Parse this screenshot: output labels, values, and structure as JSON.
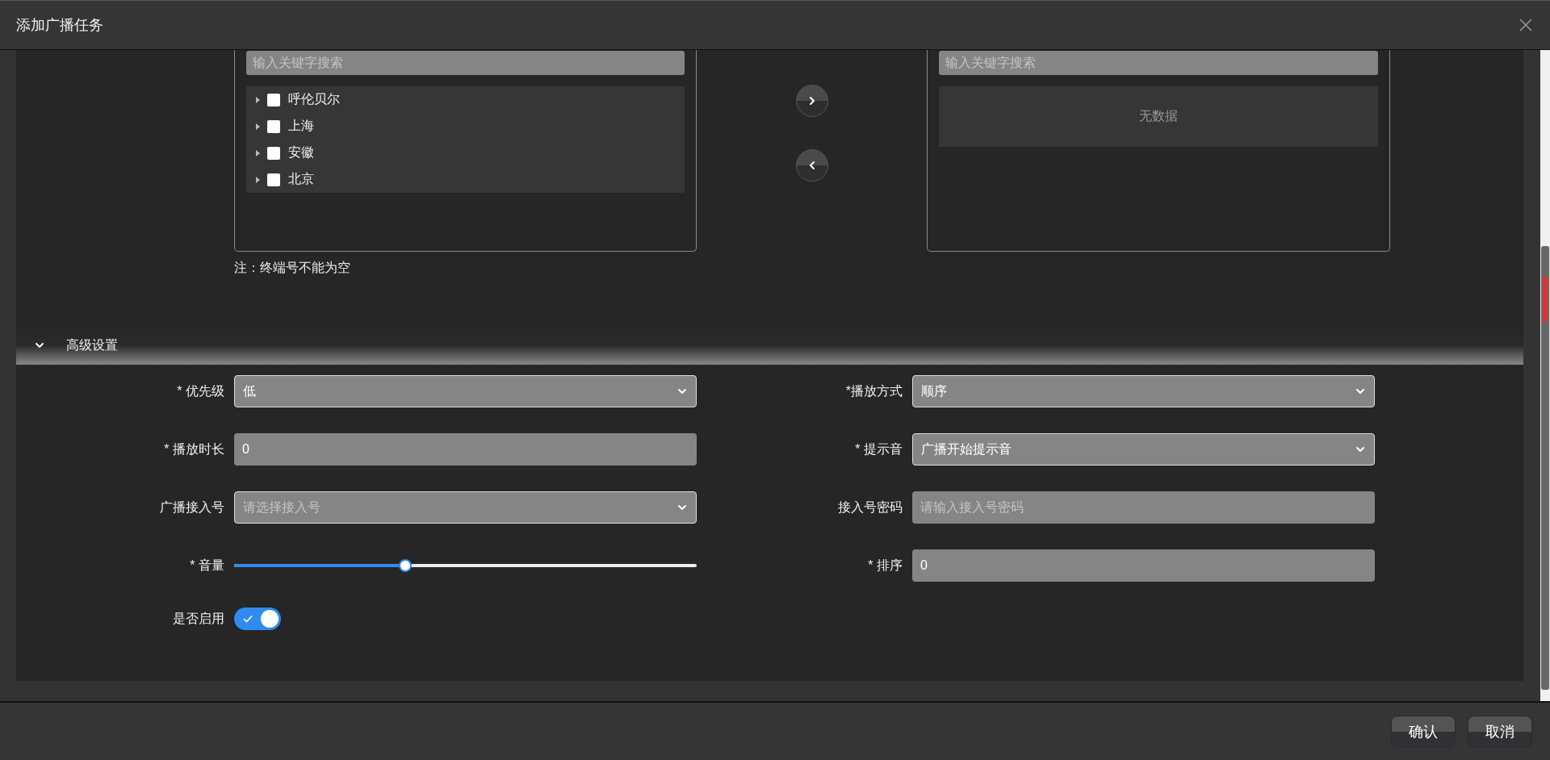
{
  "window": {
    "title": "添加广播任务"
  },
  "transfer": {
    "source": {
      "search": {
        "placeholder": "输入关键字搜索"
      },
      "tree": [
        {
          "label": "呼伦贝尔",
          "checked": false,
          "expanded": false
        },
        {
          "label": "上海",
          "checked": false,
          "expanded": false
        },
        {
          "label": "安徽",
          "checked": false,
          "expanded": false
        },
        {
          "label": "北京",
          "checked": false,
          "expanded": false
        }
      ]
    },
    "target": {
      "search": {
        "placeholder": "输入关键字搜索"
      },
      "empty": "无数据"
    },
    "note": "注：终端号不能为空"
  },
  "advanced": {
    "title": "高级设置",
    "expanded": true,
    "fields": [
      {
        "kind": "select",
        "label": "* 优先级",
        "value": "低"
      },
      {
        "kind": "select",
        "label": "*播放方式",
        "value": "顺序"
      },
      {
        "kind": "input",
        "label": "* 播放时长",
        "value": "0"
      },
      {
        "kind": "select",
        "label": "* 提示音",
        "value": "广播开始提示音"
      },
      {
        "kind": "select",
        "label": "广播接入号",
        "placeholder": "请选择接入号"
      },
      {
        "kind": "input",
        "label": "接入号密码",
        "placeholder": "请输入接入号密码"
      },
      {
        "kind": "slider",
        "label": "* 音量",
        "level": 0.37
      },
      {
        "kind": "input",
        "label": "* 排序",
        "value": "0"
      },
      {
        "kind": "switch",
        "label": "是否启用",
        "on": true
      }
    ]
  },
  "buttons": [
    "确认",
    "取消"
  ]
}
